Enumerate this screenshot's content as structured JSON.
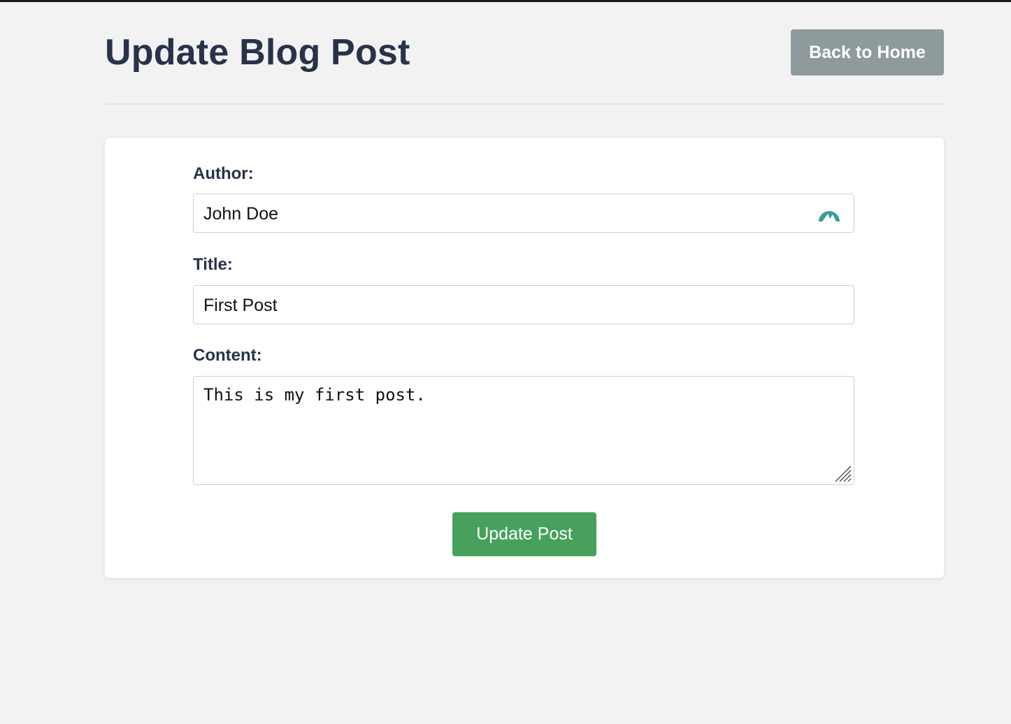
{
  "header": {
    "title": "Update Blog Post",
    "back_label": "Back to Home"
  },
  "form": {
    "author": {
      "label": "Author:",
      "value": "John Doe",
      "icon": "mountain-extension-icon"
    },
    "title": {
      "label": "Title:",
      "value": "First Post"
    },
    "content": {
      "label": "Content:",
      "value": "This is my first post."
    },
    "submit_label": "Update Post"
  },
  "colors": {
    "heading": "#28334a",
    "back_button": "#8e9a9c",
    "submit_button": "#47a15c",
    "page_background": "#f2f2f2",
    "icon_teal": "#3a9ea0"
  }
}
